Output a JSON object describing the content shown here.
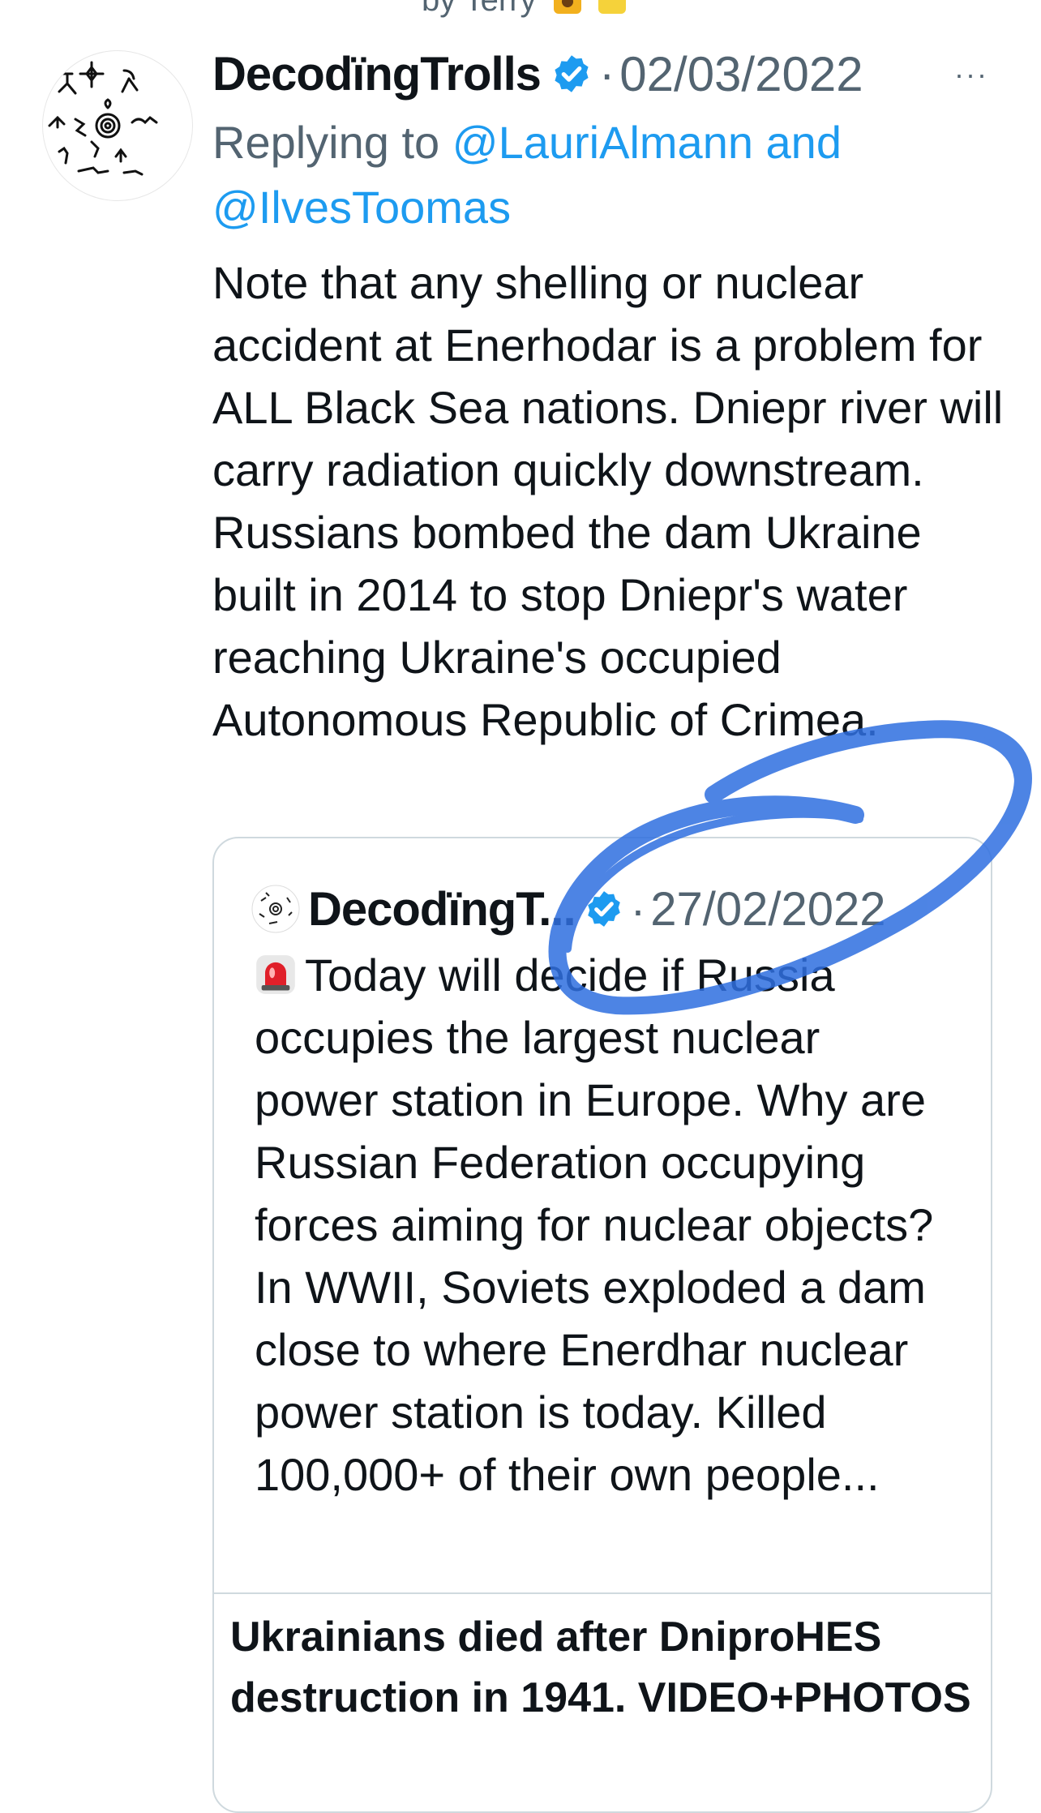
{
  "top_strip": {
    "text": "by Terry"
  },
  "tweet": {
    "author_name": "DecodïngTrolls",
    "separator": "·",
    "date": "02/03/2022",
    "more_label": "···",
    "replying_prefix": "Replying to ",
    "reply_handles_line1": "@LauriAlmann and",
    "reply_handles_line2": "@IlvesToomas",
    "text": "Note that any shelling or nuclear accident at Enerhodar is a problem for ALL Black Sea nations. Dniepr river will carry radiation quickly downstream. Russians bombed the dam Ukraine built in 2014 to stop Dniepr's water reaching Ukraine's occupied Autonomous Republic of Crimea."
  },
  "quote": {
    "author_name": "DecodïngT...",
    "separator": "·",
    "date": "27/02/2022",
    "text": "Today will decide if Russia occupies the largest nuclear power station in Europe. Why are Russian Federation occupying forces aiming for nuclear objects? In WWII, Soviets exploded a dam close to where Enerdhar nuclear power station is today. Killed 100,000+ of their own people...",
    "link_card_title": "Ukrainians died after DniproHES destruction in 1941. VIDEO+PHOTOS"
  },
  "colors": {
    "verified_blue": "#1d9bf0",
    "muted_text": "#536471",
    "scribble_blue": "#2f6fe0"
  },
  "icons": {
    "verified": "verified-badge-icon",
    "siren": "police-siren-icon",
    "more": "more-options-icon"
  }
}
